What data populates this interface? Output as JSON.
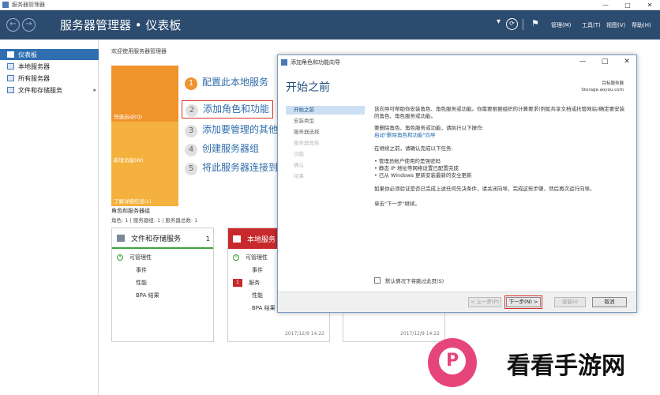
{
  "window": {
    "title": "服务器管理器",
    "controls": [
      "—",
      "□",
      "✕"
    ]
  },
  "header": {
    "breadcrumb": "服务器管理器 • 仪表板",
    "menus": [
      "管理(M)",
      "工具(T)",
      "视图(V)",
      "帮助(H)"
    ],
    "nav_back": "←",
    "nav_forward": "→",
    "refresh": "⟳",
    "dropdown": "▾",
    "flag": "⚑"
  },
  "sidebar": {
    "items": [
      {
        "label": "仪表板",
        "active": true
      },
      {
        "label": "本地服务器",
        "active": false
      },
      {
        "label": "所有服务器",
        "active": false
      },
      {
        "label": "文件和存储服务",
        "active": false,
        "chevron": "▸"
      }
    ]
  },
  "main": {
    "welcome": "欢迎使用服务器管理器",
    "quickstart_labels": [
      "快速启动(Q)",
      "新增功能(W)",
      "了解详细信息(L)"
    ],
    "steps": [
      {
        "num": "1",
        "text": "配置此本地服务"
      },
      {
        "num": "2",
        "text": "添加角色和功能"
      },
      {
        "num": "3",
        "text": "添加要管理的其他"
      },
      {
        "num": "4",
        "text": "创建服务器组"
      },
      {
        "num": "5",
        "text": "将此服务器连接到"
      }
    ],
    "roles_title": "角色和服务器组",
    "roles_subtitle": "角色: 1 | 服务器组: 1 | 服务器总数: 1",
    "cards": [
      {
        "title": "文件和存储服务",
        "count": "1",
        "rows": [
          "可管理性",
          "事件",
          "性能",
          "BPA 结果"
        ],
        "timestamp": ""
      },
      {
        "title": "本地服务",
        "count": "",
        "rows": [
          "可管理性",
          "事件",
          "服务",
          "性能",
          "BPA 结果"
        ],
        "service_badge": "1",
        "timestamp": "2017/12/9 14:22"
      },
      {
        "title": "",
        "count": "",
        "rows": [],
        "timestamp": "2017/12/9 14:22"
      }
    ]
  },
  "dialog": {
    "title": "添加角色和功能向导",
    "controls": [
      "—",
      "□",
      "✕"
    ],
    "heading": "开始之前",
    "server_label": "目标服务器",
    "server_name": "Storage.aoyou.com",
    "nav": [
      {
        "label": "开始之前",
        "state": "active"
      },
      {
        "label": "安装类型",
        "state": "normal"
      },
      {
        "label": "服务器选择",
        "state": "normal"
      },
      {
        "label": "服务器角色",
        "state": "disabled"
      },
      {
        "label": "功能",
        "state": "disabled"
      },
      {
        "label": "确认",
        "state": "disabled"
      },
      {
        "label": "结果",
        "state": "disabled"
      }
    ],
    "body": {
      "para1": "该向导可帮助你安装角色、角色服务或功能。你需要根据组织的计算要求(例如共享文档或托管网站)确定要安装的角色、角色服务或功能。",
      "para2": "要删除角色、角色服务或功能，请执行以下操作:",
      "link": "启动\"删除角色和功能\"向导",
      "para3": "在继续之前，请确认完成以下任务:",
      "bullets": [
        "管理员帐户使用的是强密码",
        "静态 IP 地址等网络设置已配置完成",
        "已从 Windows 更新安装最新的安全更新"
      ],
      "para4": "如果你必须验证是否已完成上述任何先决条件，请关闭向导，完成这些步骤，然后再次运行向导。",
      "para5": "单击\"下一步\"继续。"
    },
    "skip_label": "默认情况下将跳过此页(S)",
    "buttons": {
      "prev": "< 上一步(P)",
      "next": "下一步(N) >",
      "install": "安装(I)",
      "cancel": "取消"
    }
  },
  "watermark": {
    "logo_glyph": "P",
    "text": "看看手游网"
  }
}
